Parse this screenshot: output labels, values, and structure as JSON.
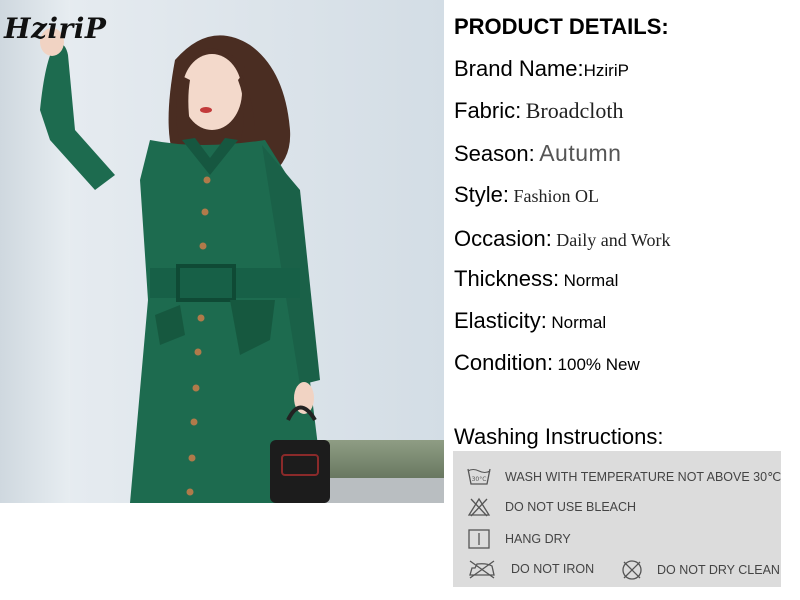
{
  "brand_logo": "HziriP",
  "details": {
    "title": "PRODUCT DETAILS:",
    "rows": [
      {
        "label": "Brand Name:",
        "value": "HziriP"
      },
      {
        "label": "Fabric:",
        "value": "Broadcloth"
      },
      {
        "label": "Season:",
        "value": "Autumn"
      },
      {
        "label": "Style:",
        "value": "Fashion OL"
      },
      {
        "label": "Occasion:",
        "value": "Daily and Work"
      },
      {
        "label": "Thickness:",
        "value": "Normal"
      },
      {
        "label": "Elasticity:",
        "value": "Normal"
      },
      {
        "label": "Condition:",
        "value": "100% New"
      }
    ]
  },
  "washing": {
    "title": "Washing Instructions:",
    "wash_icon_text": "30°C",
    "items": [
      {
        "icon": "wash-30-icon",
        "text": "WASH WITH TEMPERATURE NOT ABOVE 30℃"
      },
      {
        "icon": "no-bleach-icon",
        "text": "DO NOT USE BLEACH"
      },
      {
        "icon": "hang-dry-icon",
        "text": "HANG DRY"
      },
      {
        "icon": "no-iron-icon",
        "text": "DO NOT IRON"
      },
      {
        "icon": "no-dry-clean-icon",
        "text": "DO NOT DRY CLEAN"
      }
    ]
  },
  "colors": {
    "dress_green": "#1d6b4f",
    "wash_box_bg": "#dcdcdc"
  }
}
